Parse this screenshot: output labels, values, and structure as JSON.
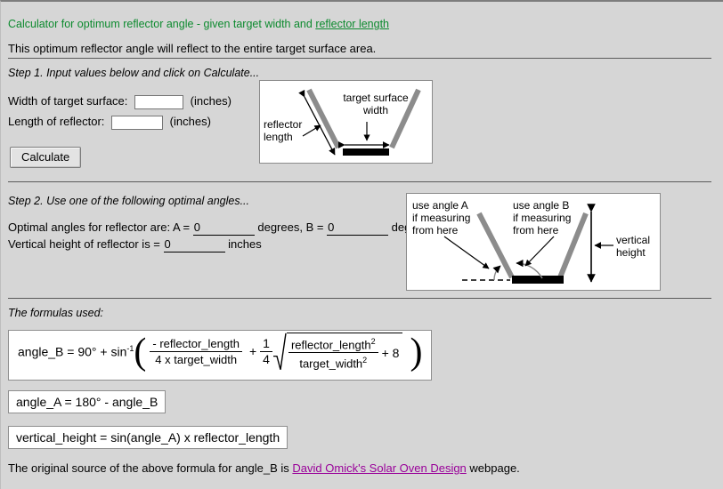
{
  "heading": {
    "title_pre": "Calculator for optimum reflector angle - given target width and ",
    "title_link": "reflector length",
    "subtitle": "This optimum reflector angle will reflect to the entire target surface area."
  },
  "step1": {
    "label": "Step 1. Input values below and click on Calculate...",
    "width_label": "Width of target surface:",
    "width_value": "",
    "width_units": "(inches)",
    "length_label": "Length of reflector:",
    "length_value": "",
    "length_units": "(inches)",
    "calculate_button": "Calculate"
  },
  "diagram1": {
    "label_reflector_length_line1": "reflector",
    "label_reflector_length_line2": "length",
    "label_target_line1": "target surface",
    "label_target_line2": "width"
  },
  "step2": {
    "label": "Step 2. Use one of the following optimal angles...",
    "angles_prefix": "Optimal angles for reflector are: A = ",
    "angle_a_value": "0",
    "degrees_comma": " degrees, B = ",
    "angle_b_value": "0",
    "degrees_period": " degrees.",
    "height_prefix": "Vertical height of reflector is = ",
    "height_value": "0",
    "height_units": " inches"
  },
  "diagram2": {
    "angle_a_line1": "use angle A",
    "angle_a_line2": "if measuring",
    "angle_a_line3": "from here",
    "angle_b_line1": "use angle B",
    "angle_b_line2": "if measuring",
    "angle_b_line3": "from here",
    "vertical_line1": "vertical",
    "vertical_line2": "height"
  },
  "formulas": {
    "label": "The formulas used:",
    "b": {
      "lhs": "angle_B = 90° + sin",
      "lhs_exp": "-1",
      "paren_open": "(",
      "frac1_num_sign": "-",
      "frac1_num": "reflector_length",
      "frac1_den": "4 x target_width",
      "plus": "+",
      "quarter_num": "1",
      "quarter_den": "4",
      "sq_num": "reflector_length",
      "sq_num_exp": "2",
      "sq_den": "target_width",
      "sq_den_exp": "2",
      "plus8": "+ 8",
      "paren_close": ")"
    },
    "a": "angle_A = 180° - angle_B",
    "h": "vertical_height = sin(angle_A) x reflector_length"
  },
  "footer": {
    "pre": "The original source of the above formula for angle_B is ",
    "link": "David Omick's Solar Oven Design",
    "post": " webpage."
  },
  "colors": {
    "page_background": "#d6d6d6",
    "heading_green": "#0c8a2e",
    "link_purple": "#990099",
    "reflector_gray": "#8c8c8c",
    "target_black": "#000000"
  }
}
